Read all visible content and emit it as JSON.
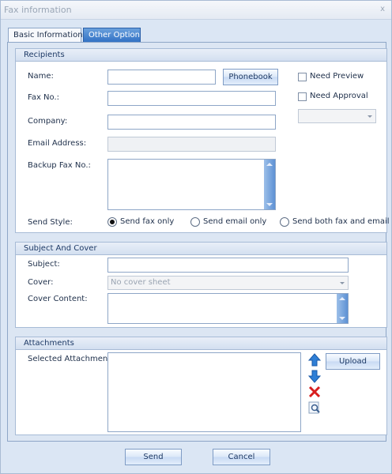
{
  "window": {
    "title": "Fax information",
    "close_glyph": "x"
  },
  "tabs": [
    {
      "label": "Basic Information",
      "selected": true
    },
    {
      "label": "Other Option",
      "selected": false
    }
  ],
  "recipients": {
    "title": "Recipients",
    "name_label": "Name:",
    "name_value": "",
    "phonebook_button": "Phonebook",
    "need_preview_label": "Need Preview",
    "need_preview_checked": false,
    "need_approval_label": "Need Approval",
    "need_approval_checked": false,
    "approval_select_value": "",
    "fax_label": "Fax No.:",
    "fax_value": "",
    "company_label": "Company:",
    "company_value": "",
    "email_label": "Email Address:",
    "email_value": "",
    "backup_fax_label": "Backup Fax No.:",
    "backup_fax_value": "",
    "send_style_label": "Send Style:",
    "send_style_options": [
      "Send fax only",
      "Send email only",
      "Send both fax and email"
    ],
    "send_style_selected": "Send fax only"
  },
  "subject_cover": {
    "title": "Subject And Cover",
    "subject_label": "Subject:",
    "subject_value": "",
    "cover_label": "Cover:",
    "cover_value": "No cover sheet",
    "cover_content_label": "Cover Content:",
    "cover_content_value": ""
  },
  "attachments": {
    "title": "Attachments",
    "selected_label": "Selected Attachments:",
    "upload_button": "Upload",
    "icons": [
      "move-up-icon",
      "move-down-icon",
      "delete-icon",
      "preview-icon"
    ],
    "colors": {
      "move": "#2f7fd6",
      "delete": "#d81e1e"
    }
  },
  "footer": {
    "send_button": "Send",
    "cancel_button": "Cancel"
  }
}
